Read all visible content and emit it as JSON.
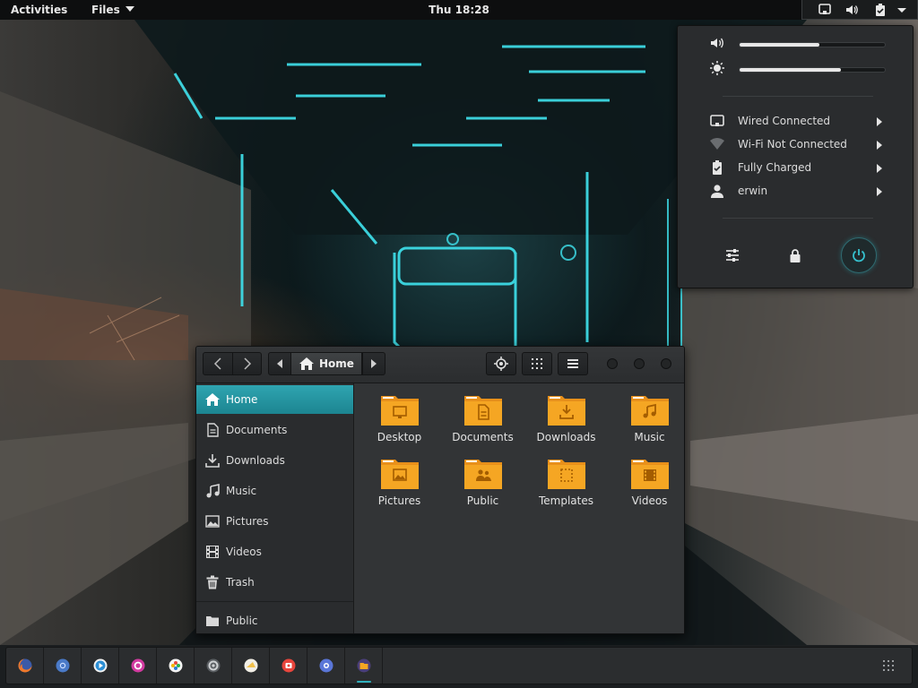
{
  "topbar": {
    "activities": "Activities",
    "app_menu": "Files",
    "clock": "Thu 18:28",
    "status_icons": [
      "network-wired-icon",
      "volume-icon",
      "battery-icon",
      "menu-arrow-icon"
    ]
  },
  "system_menu": {
    "volume_level": 0.55,
    "brightness_level": 0.7,
    "items": [
      {
        "icon": "network-wired-icon",
        "label": "Wired Connected"
      },
      {
        "icon": "wifi-icon",
        "label": "Wi-Fi Not Connected"
      },
      {
        "icon": "battery-icon",
        "label": "Fully Charged"
      },
      {
        "icon": "user-icon",
        "label": "erwin"
      }
    ],
    "buttons": [
      "settings-icon",
      "lock-icon",
      "power-icon"
    ],
    "accent": "#2fa5b1"
  },
  "file_manager": {
    "path": {
      "current": "Home"
    },
    "sidebar": [
      {
        "icon": "home-icon",
        "label": "Home",
        "active": true
      },
      {
        "icon": "documents-icon",
        "label": "Documents"
      },
      {
        "icon": "downloads-icon",
        "label": "Downloads"
      },
      {
        "icon": "music-icon",
        "label": "Music"
      },
      {
        "icon": "pictures-icon",
        "label": "Pictures"
      },
      {
        "icon": "videos-icon",
        "label": "Videos"
      },
      {
        "icon": "trash-icon",
        "label": "Trash"
      },
      {
        "icon": "folder-icon",
        "label": "Public"
      }
    ],
    "folders": [
      {
        "icon": "desktop",
        "label": "Desktop"
      },
      {
        "icon": "documents",
        "label": "Documents"
      },
      {
        "icon": "downloads",
        "label": "Downloads"
      },
      {
        "icon": "music",
        "label": "Music"
      },
      {
        "icon": "pictures",
        "label": "Pictures"
      },
      {
        "icon": "public",
        "label": "Public"
      },
      {
        "icon": "templates",
        "label": "Templates"
      },
      {
        "icon": "videos",
        "label": "Videos"
      }
    ],
    "folder_color": "#f5a623"
  },
  "dock": {
    "apps": [
      "firefox-icon",
      "chromium-icon",
      "videos-app-icon",
      "app-icon",
      "photos-icon",
      "settings-app-icon",
      "cheese-icon",
      "software-icon",
      "app-icon",
      "files-app-icon"
    ],
    "running_index": 9
  }
}
